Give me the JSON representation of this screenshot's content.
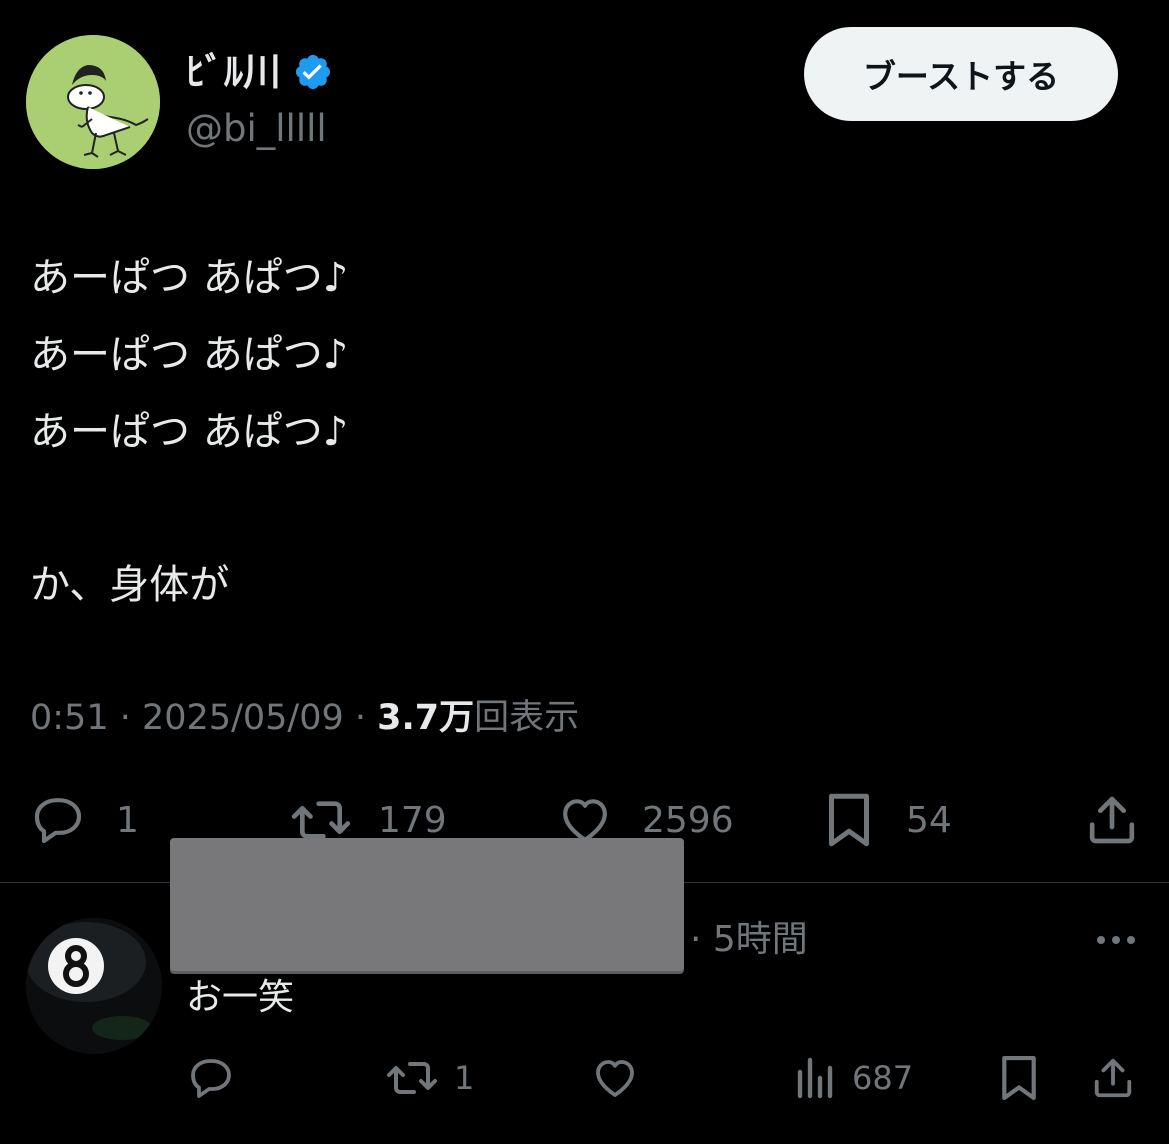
{
  "post": {
    "author": {
      "display_name": "ﾋﾞﾙ川",
      "handle": "@bi_lllll",
      "verified": true,
      "avatar_icon": "dinosaur-illustration-avatar"
    },
    "boost_label": "ブーストする",
    "lines": [
      "あーぱつ あぱつ♪",
      "あーぱつ あぱつ♪",
      "あーぱつ あぱつ♪",
      "か、身体が"
    ],
    "meta": {
      "time": "0:51",
      "sep1": " · ",
      "date": "2025/05/09",
      "sep2": " · ",
      "views_count": "3.7万",
      "views_suffix": "回表示"
    },
    "actions": {
      "replies": "1",
      "reposts": "179",
      "likes": "2596",
      "bookmarks": "54"
    }
  },
  "reply": {
    "avatar_icon": "eight-ball-avatar",
    "time": "· 5時間",
    "text": "お一笑",
    "actions": {
      "reposts": "1",
      "views": "687"
    }
  },
  "colors": {
    "background": "#000000",
    "text": "#e7e9ea",
    "muted": "#71767b",
    "verified": "#1d9bf0",
    "button_bg": "#eff3f4",
    "divider": "#2f3336",
    "redaction": "#78787a"
  }
}
